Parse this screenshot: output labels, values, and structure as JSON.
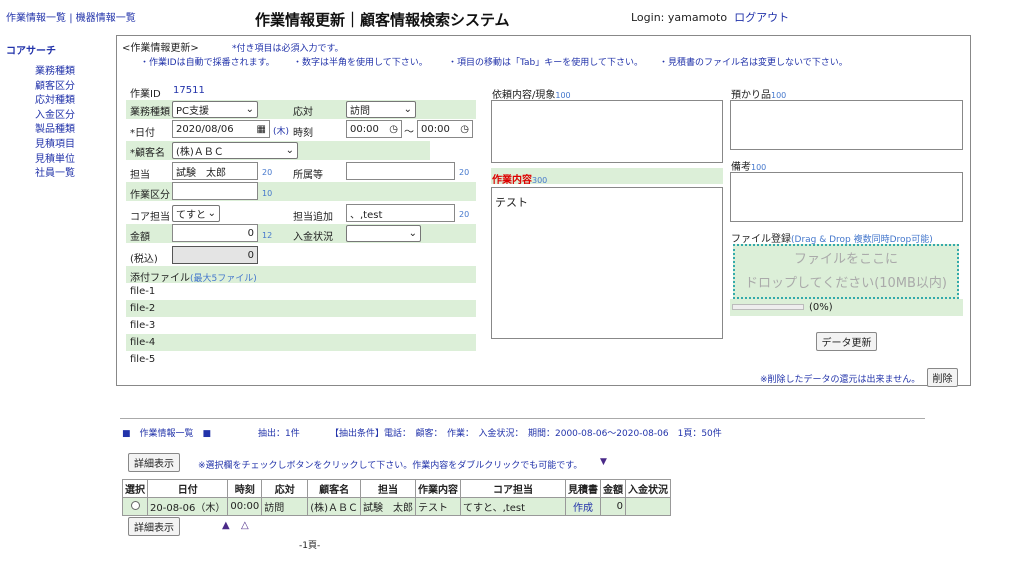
{
  "topnav": {
    "link1": "作業情報一覧",
    "sep": "|",
    "link2": "機器情報一覧"
  },
  "title": "作業情報更新｜顧客情報検索システム",
  "login": {
    "label": "Login: yamamoto",
    "logout": "ログアウト"
  },
  "sidebar": {
    "title": "コアサーチ",
    "items": [
      "業務種類",
      "顧客区分",
      "応対種類",
      "入金区分",
      "製品種類",
      "見積項目",
      "見積単位",
      "社員一覧"
    ]
  },
  "form": {
    "header": "<作業情報更新>",
    "required_note": "*付き項目は必須入力です。",
    "notes": [
      "・作業IDは自動で採番されます。",
      "・数字は半角を使用して下さい。",
      "・項目の移動は「Tab」キーを使用して下さい。",
      "・見積書のファイル名は変更しないで下さい。"
    ],
    "work_id_label": "作業ID",
    "work_id": "17511",
    "business_type_label": "業務種類",
    "business_type": "PC支援",
    "response_label": "応対",
    "response": "訪問",
    "date_label": "*日付",
    "date": "2020/08/06",
    "weekday": "(木)",
    "time_label": "時刻",
    "time_from": "00:00",
    "time_sep": "～",
    "time_to": "00:00",
    "customer_label": "*顧客名",
    "customer": "(株)ＡＢＣ",
    "staff_label": "担当",
    "staff": "試験　太郎",
    "staff_hint": "20",
    "affiliation_label": "所属等",
    "affiliation": "",
    "affiliation_hint": "20",
    "work_class_label": "作業区分",
    "work_class": "",
    "work_class_hint": "10",
    "core_staff_label": "コア担当",
    "core_staff": "てすと",
    "add_staff_label": "担当追加",
    "add_staff": "、,test",
    "add_staff_hint": "20",
    "amount_label": "金額",
    "amount": "0",
    "amount_hint": "12",
    "payment_label": "入金状況",
    "payment": "",
    "tax_label": "(税込)",
    "tax": "0",
    "attach_label": "添付ファイル",
    "attach_hint": "(最大5ファイル)",
    "files": [
      "file-1",
      "file-2",
      "file-3",
      "file-4",
      "file-5"
    ],
    "request_label": "依頼内容/現象",
    "request_hint": "100",
    "request": "",
    "work_content_label": "作業内容",
    "work_content_hint": "300",
    "work_content": "テスト",
    "deposit_label": "預かり品",
    "deposit_hint": "100",
    "deposit": "",
    "remarks_label": "備考",
    "remarks_hint": "100",
    "remarks": "",
    "file_reg_label": "ファイル登録",
    "file_reg_hint": "(Drag & Drop 複数同時Drop可能)",
    "drop_line1": "ファイルをここに",
    "drop_line2": "ドロップしてください(10MB以内)",
    "progress_text": "(0%)",
    "progress": 0,
    "update_button": "データ更新",
    "delete_note": "※削除したデータの還元は出来ません。",
    "delete_button": "削除"
  },
  "list": {
    "heading": "■　作業情報一覧　■",
    "extract": "抽出：1件",
    "conditions": "【抽出条件】電話：　顧客：　作業：　入金状況：　期間：2000-08-06～2020-08-06　1頁：50件",
    "detail_button": "詳細表示",
    "instruction": "※選択欄をチェックしボタンをクリックして下さい。作業内容をダブルクリックでも可能です。",
    "sort_down": "▼",
    "columns": [
      "選択",
      "日付",
      "時刻",
      "応対",
      "顧客名",
      "担当",
      "作業内容",
      "コア担当",
      "見積書",
      "金額",
      "入金状況"
    ],
    "rows": [
      {
        "date": "20-08-06（木）",
        "time": "00:00",
        "response": "訪問",
        "customer": "(株)ＡＢＣ",
        "staff": "試験　太郎",
        "content": "テスト",
        "core": "てすと、,test",
        "estimate": "作成",
        "amount": "0",
        "payment": ""
      }
    ],
    "sort_up_filled": "▲",
    "sort_up_empty": "△",
    "page": "-1頁-"
  }
}
